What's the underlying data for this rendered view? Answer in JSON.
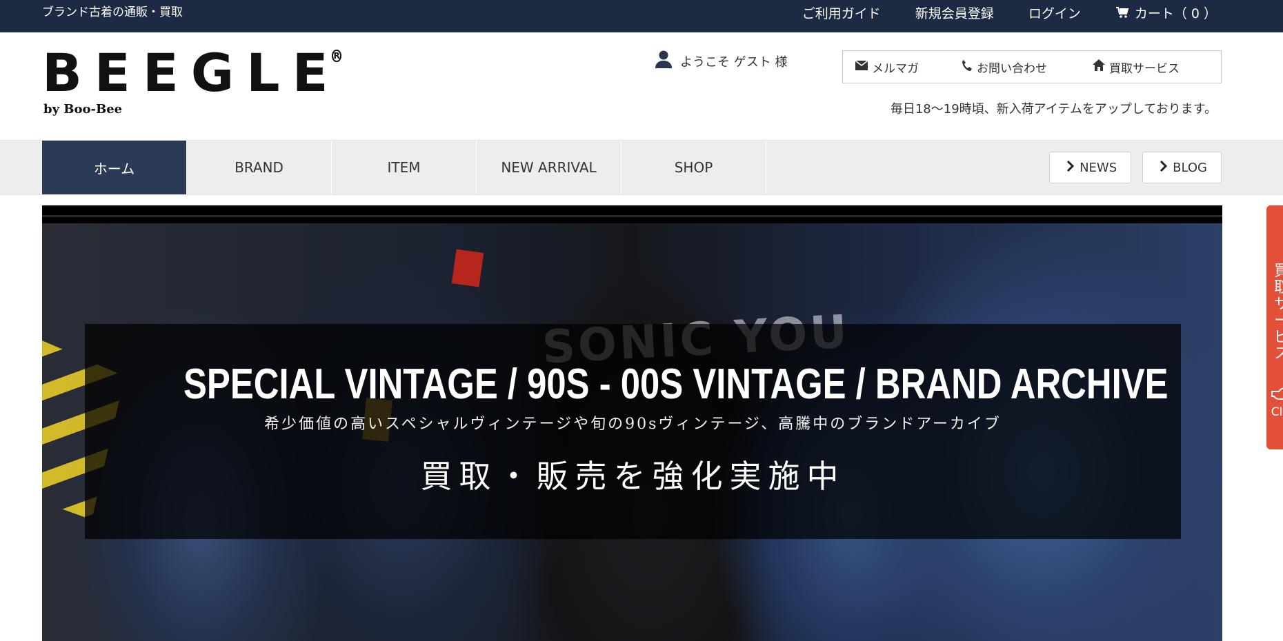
{
  "topbar": {
    "tagline": "ブランド古着の通販・買取",
    "links": {
      "guide": "ご利用ガイド",
      "register": "新規会員登録",
      "login": "ログイン",
      "cart": "カート（ 0 ）"
    }
  },
  "header": {
    "logo_text": "BEEGLE",
    "logo_byline": "by Boo-Bee",
    "welcome": "ようこそ ゲスト 様",
    "util": {
      "mailmag": "メルマガ",
      "contact": "お問い合わせ",
      "buyback": "買取サービス"
    },
    "notice": "毎日18〜19時頃、新入荷アイテムをアップしております。"
  },
  "nav": {
    "items": [
      "ホーム",
      "BRAND",
      "ITEM",
      "NEW ARRIVAL",
      "SHOP"
    ],
    "buttons": {
      "news": "NEWS",
      "blog": "BLOG"
    }
  },
  "hero": {
    "headline": "SPECIAL VINTAGE / 90S - 00S VINTAGE / BRAND ARCHIVE",
    "subline": "希少価値の高いスペシャルヴィンテージや旬の90sヴィンテージ、高騰中のブランドアーカイブ",
    "cta": "買取・販売を強化実施中",
    "tee_print": "SONIC YOU"
  },
  "sidetab": {
    "label": "買取サービス",
    "click": "Click"
  },
  "colors": {
    "topbar_bg": "#1c2a43",
    "nav_active_bg": "#2b3a55",
    "sidetab_bg": "#e2503a"
  }
}
